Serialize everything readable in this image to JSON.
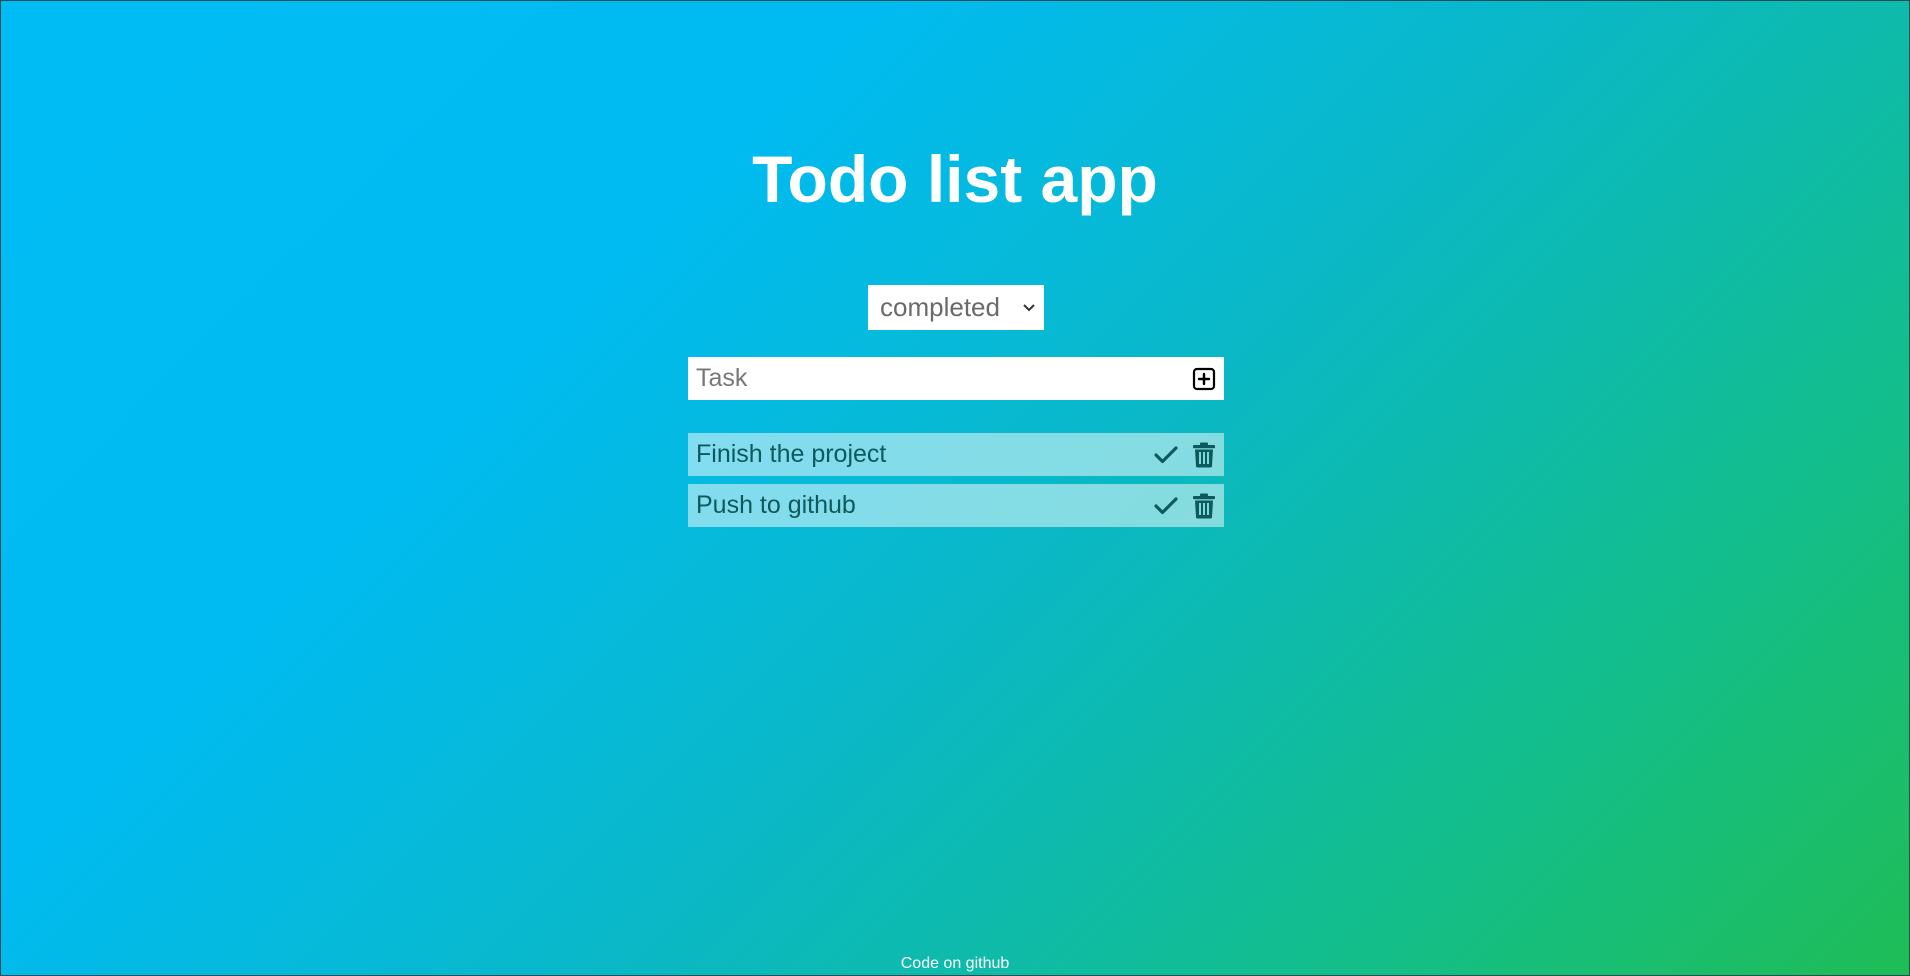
{
  "header": {
    "title": "Todo list app"
  },
  "filter": {
    "selected": "completed"
  },
  "task_input": {
    "placeholder": "Task",
    "value": ""
  },
  "todos": [
    {
      "text": "Finish the project"
    },
    {
      "text": "Push to github"
    }
  ],
  "footer": {
    "link_text": "Code on github"
  },
  "icons": {
    "add": "plus-square-icon",
    "complete": "check-icon",
    "delete": "trash-icon",
    "dropdown": "chevron-down-icon"
  },
  "colors": {
    "title_text": "#ffffff",
    "item_text": "#0d5a5e",
    "icon_dark": "#0d5a5e",
    "add_icon": "#000000"
  }
}
